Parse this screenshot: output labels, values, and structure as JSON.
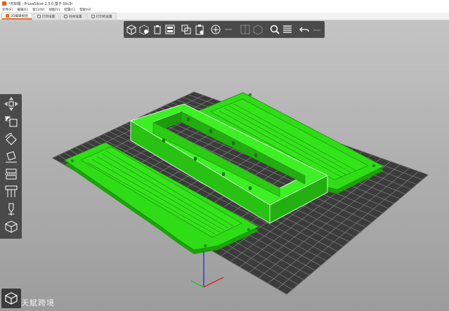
{
  "window": {
    "title": "*无标题 - PrusaSlicer-2.5.0 基于 Slic3r"
  },
  "menu": [
    "文件(F)",
    "编辑(E)",
    "窗口(W)",
    "视图(V)",
    "配置(C)",
    "帮助(H)"
  ],
  "tabs": [
    {
      "label": "3D编辑视图",
      "active": true
    },
    {
      "label": "打印设置",
      "active": false
    },
    {
      "label": "耗材设置",
      "active": false
    },
    {
      "label": "打印机设置",
      "active": false
    }
  ],
  "toolbar_top": [
    "add-icon",
    "delete-icon",
    "delete-all-icon",
    "arrange-icon",
    "copy-icon",
    "paste-icon",
    "add-instance-icon",
    "remove-instance-icon",
    "split-objects-icon",
    "split-parts-icon",
    "search-icon",
    "layers-editing-icon",
    "undo-icon",
    "redo-icon"
  ],
  "toolbar_left": [
    "move-icon",
    "scale-icon",
    "rotate-icon",
    "place-on-face-icon",
    "cut-icon",
    "support-paint-icon",
    "seam-paint-icon",
    "measure-icon"
  ],
  "watermark": "天赋跨境",
  "colors": {
    "model": "#2fdd17",
    "bed_grid": "#3b3b3b",
    "bed_line": "#8a8a8a",
    "accent": "#ed6b21"
  }
}
